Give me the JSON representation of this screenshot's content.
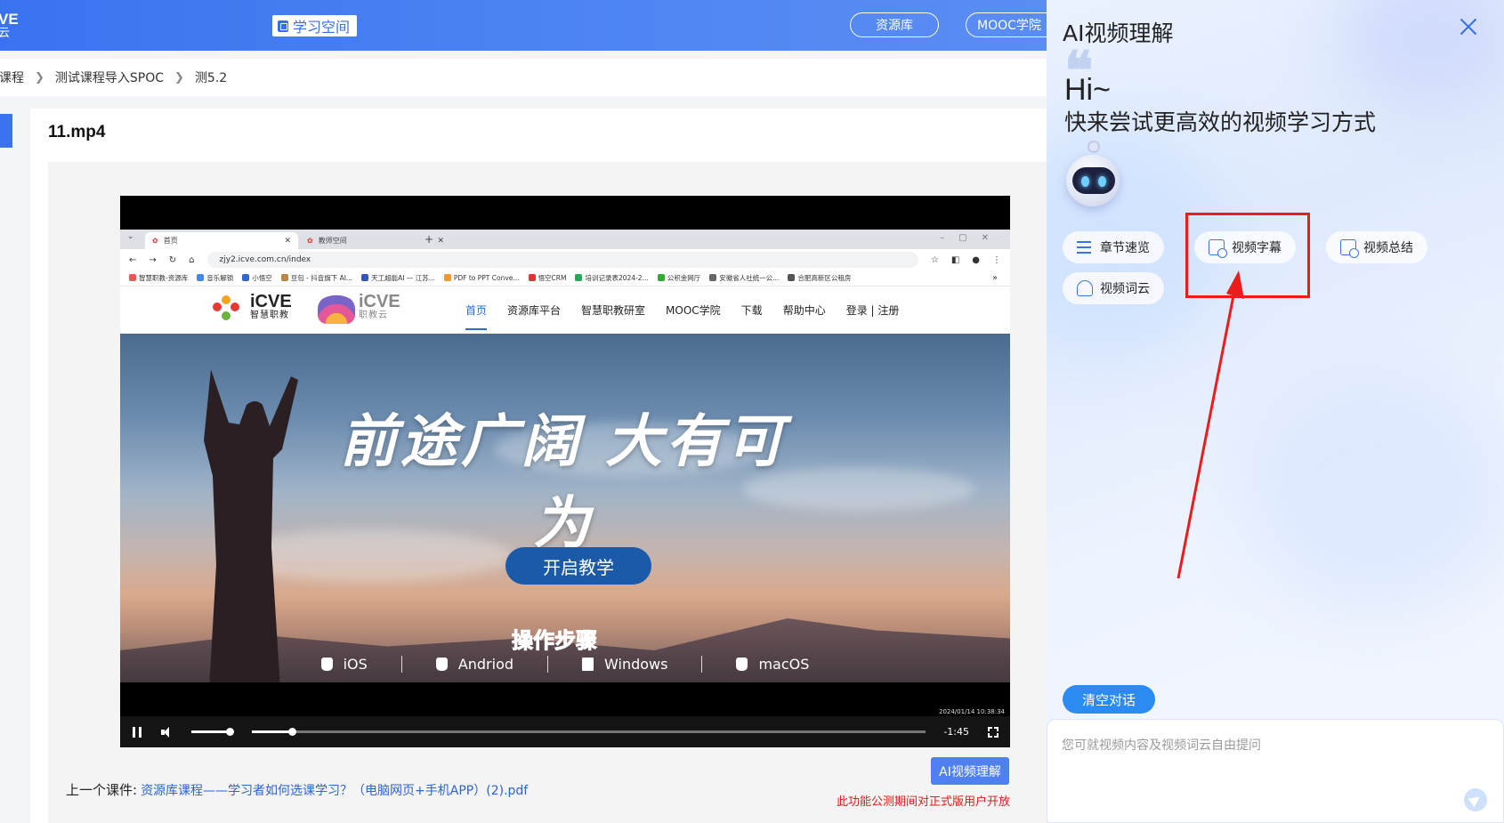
{
  "header": {
    "logo_fragment": "VE",
    "logo_fragment_sub": "云",
    "space_label": "学习空间",
    "nav": [
      "资源库",
      "MOOC学院"
    ]
  },
  "breadcrumb": [
    "课程",
    "测试课程导入SPOC",
    "测5.2"
  ],
  "file": {
    "title": "11.mp4"
  },
  "video": {
    "browser": {
      "tab_active": "首页",
      "tab_other": "教师空间",
      "url": "zjy2.icve.com.cn/index",
      "bookmarks": [
        "智慧职教-资源库",
        "音乐解锁",
        "小悟空",
        "豆包 - 抖音旗下 AI...",
        "天工超能AI — 江苏...",
        "PDF to PPT Conve...",
        "悟空CRM",
        "培训记录表2024-2...",
        "公积金网厅",
        "安徽省人社统一公...",
        "合肥高新区公租房"
      ]
    },
    "site": {
      "logo1": "iCVE",
      "logo1_sub": "智慧职教",
      "logo2": "iCVE",
      "logo2_sub": "职教云",
      "menu": [
        "首页",
        "资源库平台",
        "智慧职教研室",
        "MOOC学院",
        "下载",
        "帮助中心",
        "登录 | 注册"
      ],
      "slogan": "前途广阔 大有可为",
      "start_button": "开启教学",
      "steps_label": "操作步骤",
      "platforms": [
        "iOS",
        "Andriod",
        "Windows",
        "macOS"
      ]
    },
    "timestamp": "2024/01/14 10:38:34",
    "time_left": "-1:45",
    "progress": 0.06,
    "volume": 1.0
  },
  "footer": {
    "prev_label": "上一个课件:",
    "prev_link": "资源库课程——学习者如何选课学习？（电脑网页+手机APP）(2).pdf",
    "ai_button": "AI视频理解",
    "notice": "此功能公测期间对正式版用户开放"
  },
  "panel": {
    "title": "AI视频理解",
    "hi": "Hi~",
    "greeting": "快来尝试更高效的视频学习方式",
    "chips": [
      "章节速览",
      "视频字幕",
      "视频总结",
      "视频词云"
    ],
    "clear_button": "清空对话",
    "input_placeholder": "您可就视频内容及视频词云自由提问",
    "accent": "#3b74e8",
    "highlight_color": "#ea1c1c"
  }
}
